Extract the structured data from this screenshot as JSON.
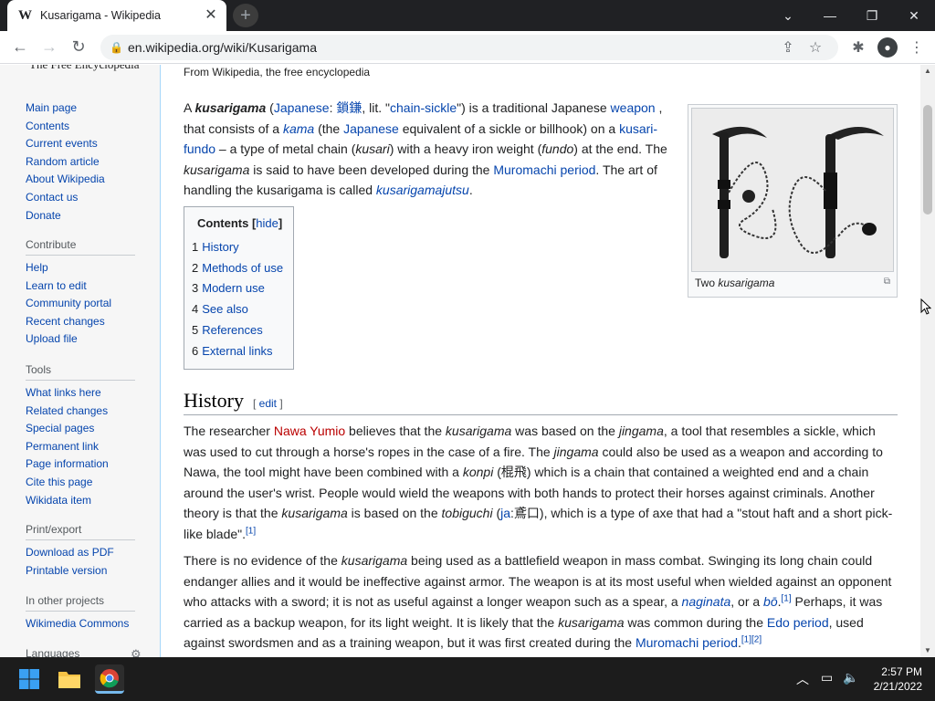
{
  "browser": {
    "tab_title": "Kusarigama - Wikipedia",
    "tab_favicon": "W",
    "url": "en.wikipedia.org/wiki/Kusarigama"
  },
  "sidebar": {
    "logo_tagline": "The Free Encyclopedia",
    "main": [
      "Main page",
      "Contents",
      "Current events",
      "Random article",
      "About Wikipedia",
      "Contact us",
      "Donate"
    ],
    "contribute_head": "Contribute",
    "contribute": [
      "Help",
      "Learn to edit",
      "Community portal",
      "Recent changes",
      "Upload file"
    ],
    "tools_head": "Tools",
    "tools": [
      "What links here",
      "Related changes",
      "Special pages",
      "Permanent link",
      "Page information",
      "Cite this page",
      "Wikidata item"
    ],
    "print_head": "Print/export",
    "print": [
      "Download as PDF",
      "Printable version"
    ],
    "projects_head": "In other projects",
    "projects": [
      "Wikimedia Commons"
    ],
    "languages_head": "Languages"
  },
  "article": {
    "from": "From Wikipedia, the free encyclopedia",
    "intro": {
      "t1": "A ",
      "b1": "kusarigama",
      "t2": " (",
      "l1": "Japanese",
      "t3": ": ",
      "l2": "鎖鎌",
      "t4": ", lit. \"",
      "l3": "chain-sickle",
      "t5": "\") is a traditional Japanese ",
      "l4": "weapon",
      "t6": " , that consists of a ",
      "l5": "kama",
      "t7": " (the ",
      "l6": "Japanese",
      "t8": " equivalent of a sickle or billhook) on a ",
      "l7": "kusari-fundo",
      "t9": " – a type of metal chain (",
      "i1": "kusari",
      "t10": ") with a heavy iron weight (",
      "i2": "fundo",
      "t11": ") at the end. The ",
      "i3": "kusarigama",
      "t12": " is said to have been developed during the ",
      "l8": "Muromachi period",
      "t13": ". The art of handling the kusarigama is called ",
      "l9": "kusarigamajutsu",
      "t14": "."
    },
    "image_caption_plain": "Two ",
    "image_caption_italic": "kusarigama",
    "toc": {
      "title": "Contents",
      "hide": "hide",
      "items": [
        {
          "num": "1",
          "label": "History"
        },
        {
          "num": "2",
          "label": "Methods of use"
        },
        {
          "num": "3",
          "label": "Modern use"
        },
        {
          "num": "4",
          "label": "See also"
        },
        {
          "num": "5",
          "label": "References"
        },
        {
          "num": "6",
          "label": "External links"
        }
      ]
    },
    "history_heading": "History",
    "edit_label": "edit",
    "p1": {
      "t1": "The researcher ",
      "r1": "Nawa Yumio",
      "t2": " believes that the ",
      "i1": "kusarigama",
      "t3": " was based on the ",
      "i2": "jingama",
      "t4": ", a tool that resembles a sickle, which was used to cut through a horse's ropes in the case of a fire. The ",
      "i3": "jingama",
      "t5": " could also be used as a weapon and according to Nawa, the tool might have been combined with a ",
      "i4": "konpi",
      "t6": " (棍飛) which is a chain that contained a weighted end and a chain around the user's wrist. People would wield the weapons with both hands to protect their horses against criminals. Another theory is that the ",
      "i5": "kusarigama",
      "t7": " is based on the ",
      "i6": "tobiguchi",
      "t8": " (",
      "l1": "ja",
      "t9": ":鳶口), which is a type of axe that had a \"stout haft and a short pick-like blade\".",
      "s1": "[1]"
    },
    "p2": {
      "t1": "There is no evidence of the ",
      "i1": "kusarigama",
      "t2": " being used as a battlefield weapon in mass combat. Swinging its long chain could endanger allies and it would be ineffective against armor. The weapon is at its most useful when wielded against an opponent who attacks with a sword; it is not as useful against a longer weapon such as a spear, a ",
      "l1": "naginata",
      "t3": ", or a ",
      "l2": "bō",
      "t4": ".",
      "s1": "[1]",
      "t5": " Perhaps, it was carried as a backup weapon, for its light weight. It is likely that the ",
      "i2": "kusarigama",
      "t6": " was common during the ",
      "l3": "Edo period",
      "t7": ", used against swordsmen and as a training weapon, but it was first created during the ",
      "l4": "Muromachi period",
      "t8": ".",
      "s2": "[1]",
      "s3": "[2]"
    }
  },
  "taskbar": {
    "time": "2:57 PM",
    "date": "2/21/2022"
  },
  "colors": {
    "link": "#0645ad",
    "redlink": "#ba0000",
    "chrome_dark": "#202124",
    "taskbar": "#1c1c1c"
  }
}
